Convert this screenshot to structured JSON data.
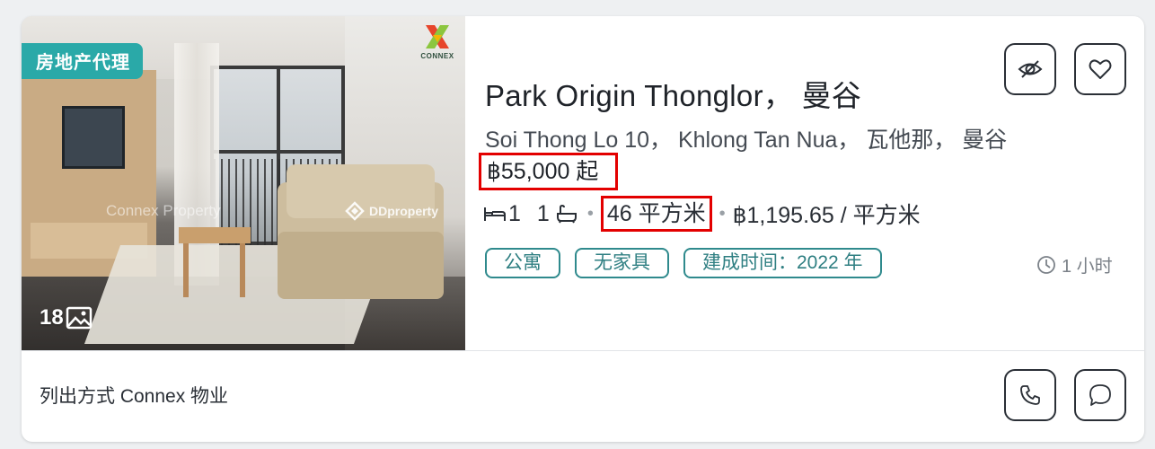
{
  "listing": {
    "agent_badge": "房地产代理",
    "brand_logo_text": "CONNEX",
    "watermark_left": "Connex Property",
    "watermark_right": "DDproperty",
    "photo_count": "18",
    "title": "Park Origin Thonglor， 曼谷",
    "address": "Soi Thong Lo 10， Khlong Tan Nua， 瓦他那， 曼谷",
    "price": "฿55,000 起",
    "bedrooms": "1",
    "bathrooms": "1",
    "area": "46 平方米",
    "price_per_sqm": "฿1,195.65 / 平方米",
    "tags": [
      "公寓",
      "无家具",
      "建成时间：2022 年"
    ],
    "posted_time": "1 小时",
    "footer": "列出方式 Connex 物业"
  },
  "icons": {
    "hide": "eye-slash-icon",
    "favorite": "heart-icon",
    "call": "phone-icon",
    "chat": "chat-bubble-icon",
    "gallery": "image-icon",
    "bed": "bed-icon",
    "bath": "bathtub-icon",
    "clock": "clock-icon"
  },
  "colors": {
    "tag_teal": "#2f8a8d",
    "badge_teal": "#2aa9a8",
    "highlight_red": "#e30000"
  }
}
